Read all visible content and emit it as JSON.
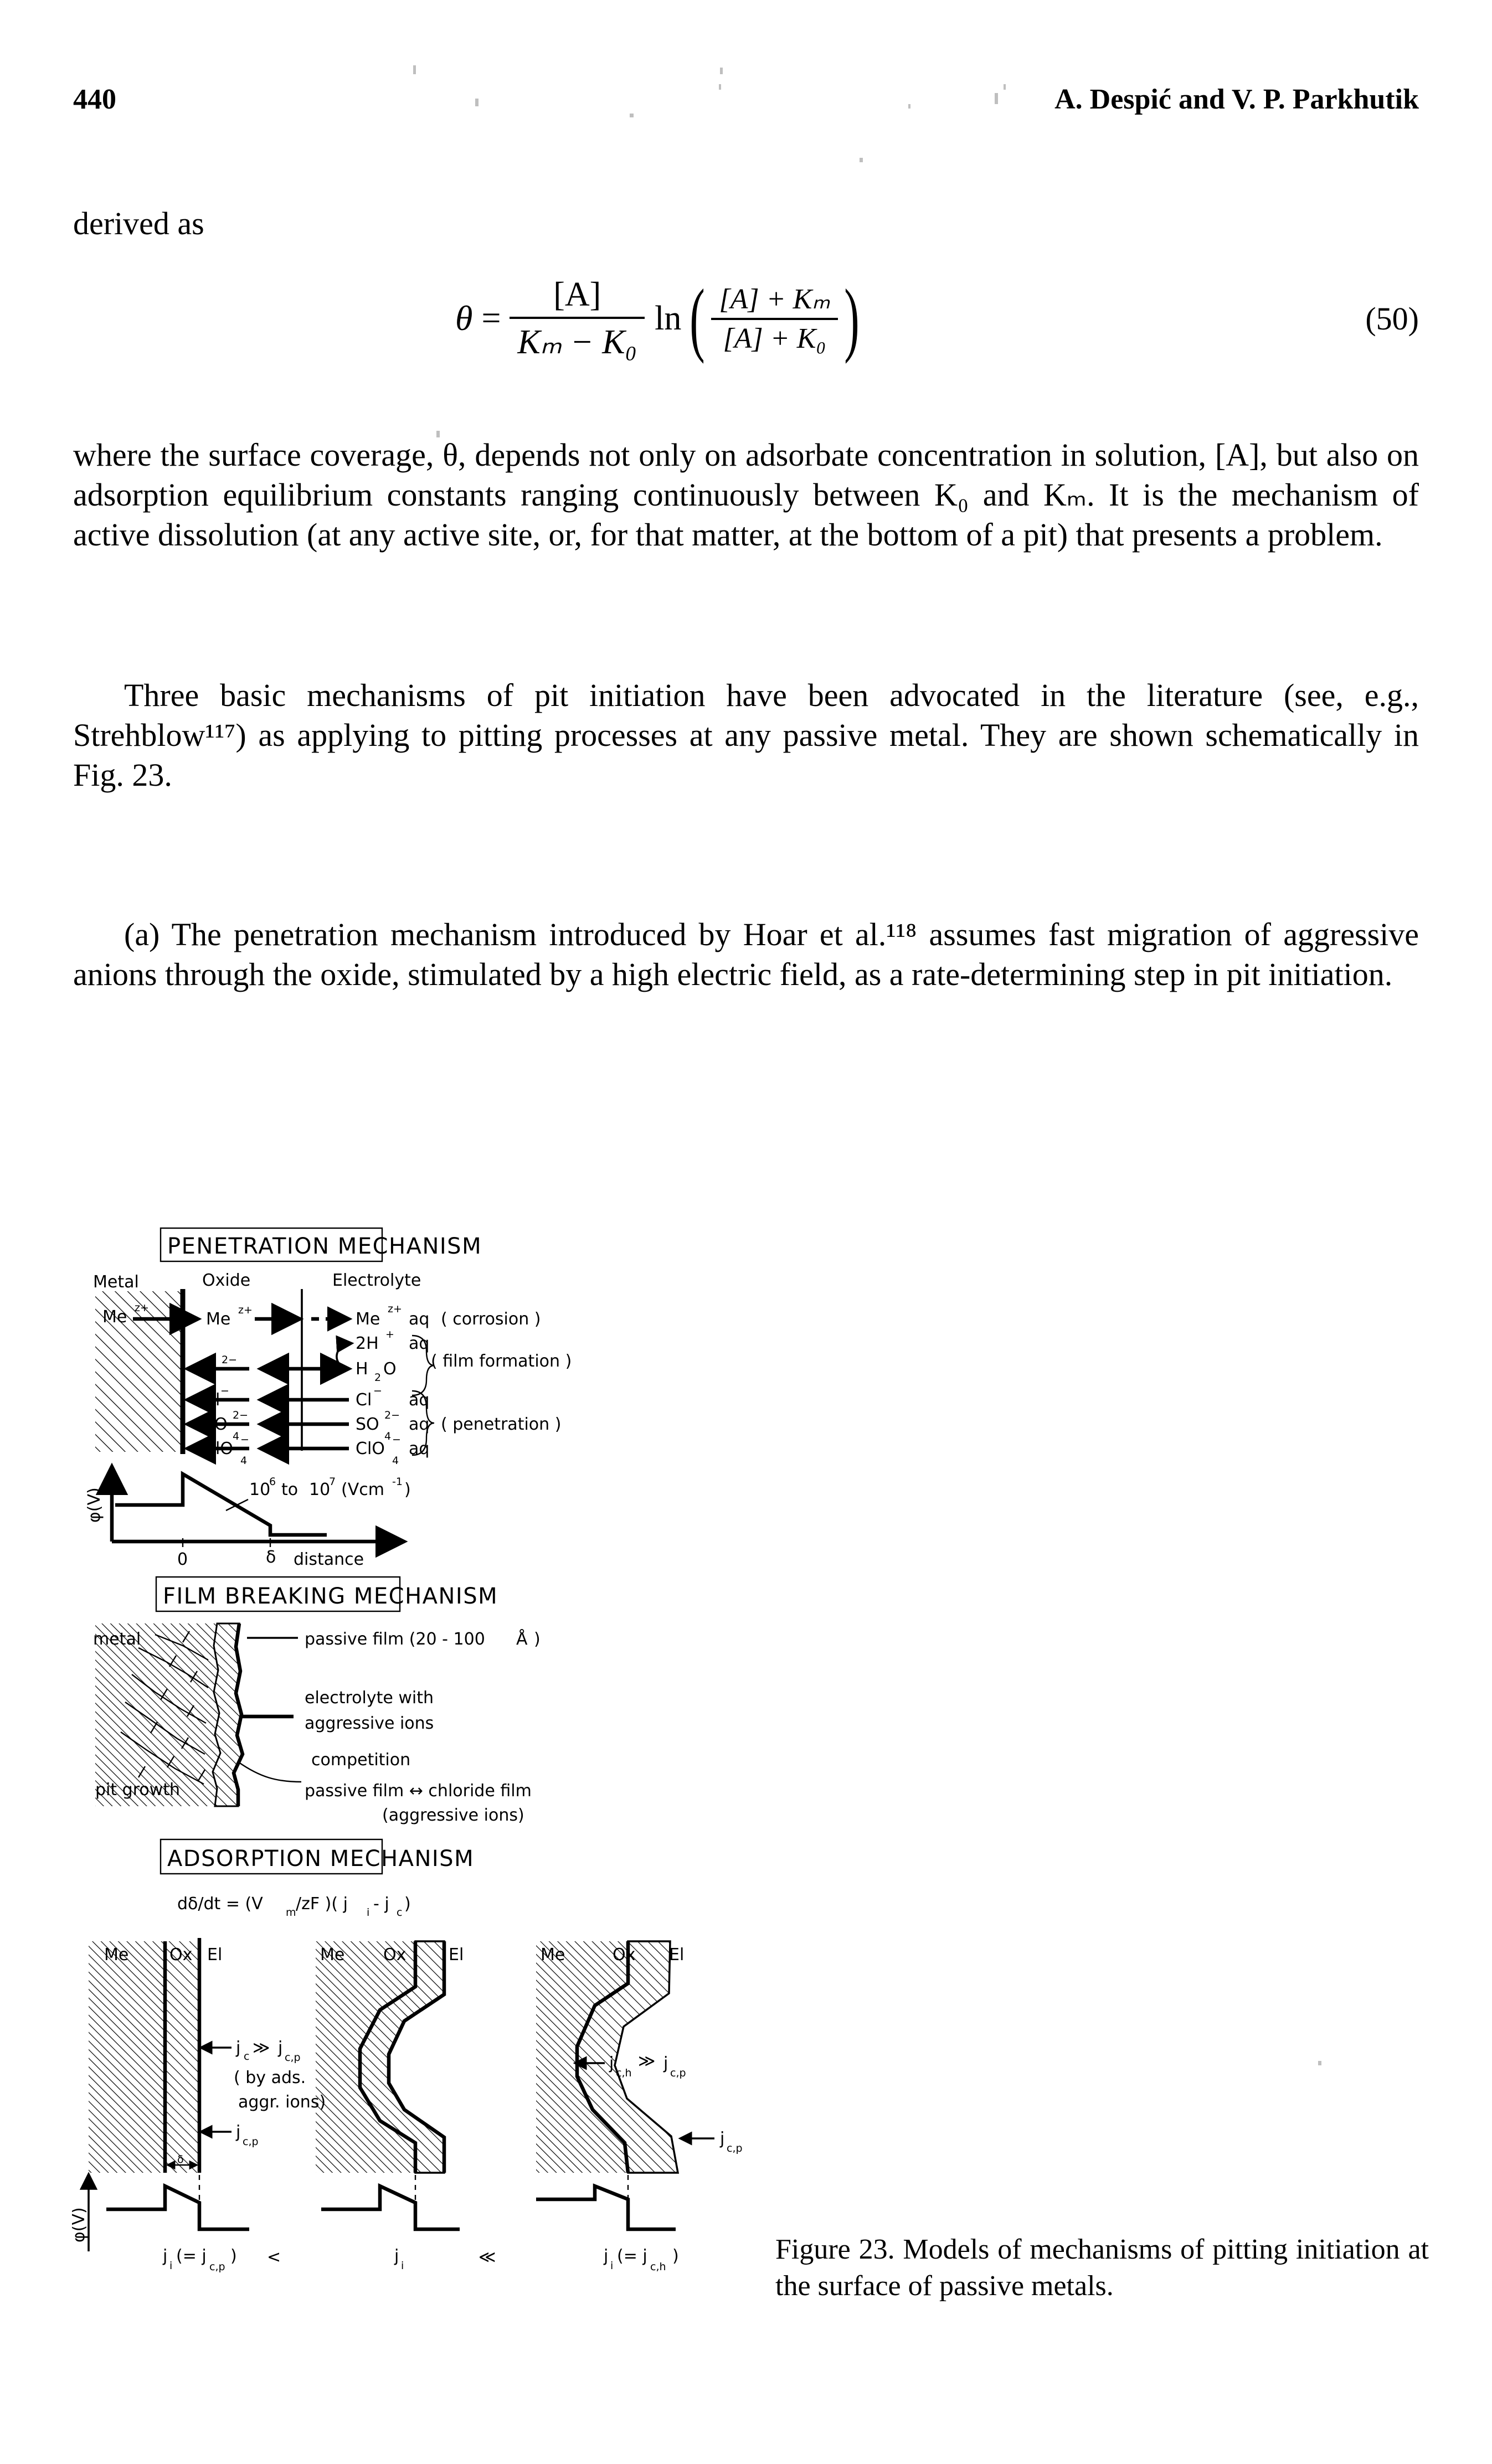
{
  "running_head": {
    "folio": "440",
    "authors": "A. Despić and V. P. Parkhutik"
  },
  "body": {
    "lead_in": "derived as",
    "equation": {
      "number": "(50)",
      "lhs": "θ",
      "equals": "=",
      "prefactor_num": "[A]",
      "prefactor_den": "Kₘ − K₀",
      "log": "ln",
      "inner_num": "[A] + Kₘ",
      "inner_den": "[A] + K₀",
      "plain": "θ = [A]/(K_m − K_0) · ln(([A] + K_m)/([A] + K_0))"
    },
    "para1": "where the surface coverage, θ, depends not only on adsorbate concentration in solution, [A], but also on adsorption equilibrium constants ranging continuously between K₀ and Kₘ. It is the mechanism of active dissolution (at any active site, or, for that matter, at the bottom of a pit) that presents a problem.",
    "para2": "Three basic mechanisms of pit initiation have been advocated in the literature (see, e.g., Strehblow¹¹⁷) as applying to pitting processes at any passive metal. They are shown schematically in Fig. 23.",
    "para3": "(a) The penetration mechanism introduced by Hoar et al.¹¹⁸ assumes fast migration of aggressive anions through the oxide, stimulated by a high electric field, as a rate-determining step in pit initiation."
  },
  "figure": {
    "caption": "Figure 23. Models of mechanisms of pitting initiation at the surface of passive metals.",
    "panel_penetration": {
      "title": "PENETRATION  MECHANISM",
      "region_labels": [
        "Metal",
        "Oxide",
        "Electrolyte"
      ],
      "metal_species": "Me",
      "metal_species_charge": "z+",
      "rows": [
        {
          "oxide": "Me",
          "oxide_sup": "z+",
          "electrolyte": "Me",
          "electrolyte_sup": "z+",
          "aq": "aq",
          "note": "( corrosion )"
        },
        {
          "oxide": "",
          "oxide_sup": "",
          "electrolyte": "2H",
          "electrolyte_sup": "+",
          "aq": "aq",
          "note": ""
        },
        {
          "oxide": "O",
          "oxide_sup": "2−",
          "electrolyte": "H",
          "electrolyte_sub": "2",
          "electrolyte_tail": "O",
          "aq": "",
          "note": "( film formation )"
        },
        {
          "oxide": "Cl",
          "oxide_sup": "−",
          "electrolyte": "Cl",
          "electrolyte_sup": "−",
          "aq": "aq",
          "note": ""
        },
        {
          "oxide": "SO",
          "oxide_sup": "2−",
          "oxide_sub": "4",
          "electrolyte": "SO",
          "electrolyte_sup": "2−",
          "electrolyte_sub": "4",
          "aq": "aq",
          "note": "( penetration )"
        },
        {
          "oxide": "ClO",
          "oxide_sup": "−",
          "oxide_sub": "4",
          "electrolyte": "ClO",
          "electrolyte_sup": "−",
          "electrolyte_sub": "4",
          "aq": "aq",
          "note": ""
        }
      ],
      "brace_labels": [
        "( corrosion )",
        "( film formation )",
        "( penetration )"
      ],
      "plot": {
        "yaxis": "φ(V)",
        "xaxis": "distance",
        "xticks": [
          "0",
          "δ"
        ],
        "field_annotation": "10⁶  to  10⁷  (Vcm⁻¹)",
        "field_base": "10",
        "field_exp_lo": "6",
        "field_exp_hi": "7",
        "field_unit": "(Vcm",
        "field_unit_exp": "-1",
        "field_unit_close": ")",
        "to_word": "to"
      }
    },
    "panel_film_breaking": {
      "title": "FILM  BREAKING  MECHANISM",
      "label_metal": "metal",
      "label_pit_growth": "pit growth",
      "callouts": [
        "passive film (20 - 100 Å)",
        "electrolyte  with",
        "aggressive  ions",
        "competition",
        "passive  film ↔ chloride  film",
        "(aggressive  ions)"
      ],
      "passive_film_text": "passive film (20 - 100",
      "angstrom": "Å",
      "passive_film_close": ")"
    },
    "panel_adsorption": {
      "title": "ADSORPTION  MECHANISM",
      "equation": "dδ/dt = (Vₘ/zF)( jᵢ - jᴄ )",
      "equation_parts": {
        "lhs": "dδ/dt",
        "eq": "=",
        "open1": "(",
        "V": "V",
        "V_sub": "m",
        "zF": "/zF",
        "close1": ")",
        "open2": "(",
        "ji": "j",
        "ji_sub": "i",
        "minus": "-",
        "jc": "j",
        "jc_sub": "c",
        "close2": ")"
      },
      "column_labels": [
        "Me",
        "Ox",
        "El"
      ],
      "panel1_annotations": {
        "a": "j",
        "a_sub": "c",
        "gg": "≫",
        "b": "j",
        "b_sub": "c,p",
        "note1": "( by ads.",
        "note2": "aggr. ions)",
        "jcp": "j",
        "jcp_sub": "c,p",
        "delta": "δ"
      },
      "panel3_annotations": {
        "a": "j",
        "a_sub": "c,h",
        "gg": "≫",
        "b": "j",
        "b_sub": "c,p",
        "jcp": "j",
        "jcp_sub": "c,p"
      },
      "yaxis": "φ(V)",
      "bottom_labels": [
        {
          "main": "j",
          "sub": "i",
          "paren": "(= j",
          "paren_sub": "c,p",
          "paren_close": ")"
        },
        {
          "rel": "<"
        },
        {
          "main": "j",
          "sub": "i"
        },
        {
          "rel": "≪"
        },
        {
          "main": "j",
          "sub": "i",
          "paren": "(= j",
          "paren_sub": "c,h",
          "paren_close": ")"
        }
      ],
      "rel_lt": "<",
      "rel_llt": "≪"
    }
  },
  "colors": {
    "ink": "#000000",
    "paper": "#ffffff",
    "speck": "#bfbfbf"
  }
}
